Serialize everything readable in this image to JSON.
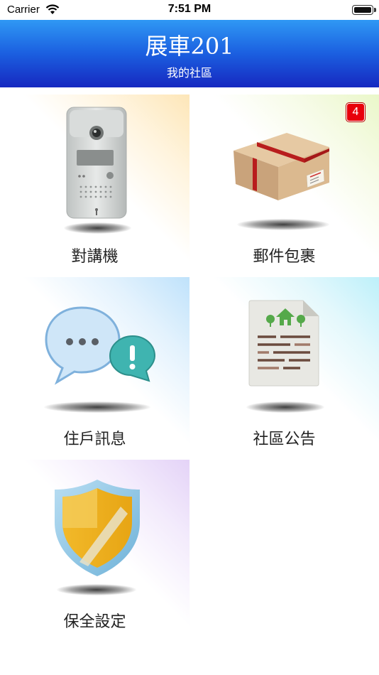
{
  "status_bar": {
    "carrier": "Carrier",
    "time": "7:51 PM"
  },
  "header": {
    "title": "展車201",
    "subtitle": "我的社區"
  },
  "menu": {
    "items": [
      {
        "label": "對講機",
        "icon": "intercom-icon"
      },
      {
        "label": "郵件包裹",
        "icon": "package-icon",
        "badge": "4"
      },
      {
        "label": "住戶訊息",
        "icon": "chat-bubbles-icon"
      },
      {
        "label": "社區公告",
        "icon": "announcement-document-icon"
      },
      {
        "label": "保全設定",
        "icon": "shield-icon"
      }
    ]
  },
  "colors": {
    "header_top": "#2f98f4",
    "header_bottom": "#1628c0",
    "badge": "#e8000b"
  }
}
